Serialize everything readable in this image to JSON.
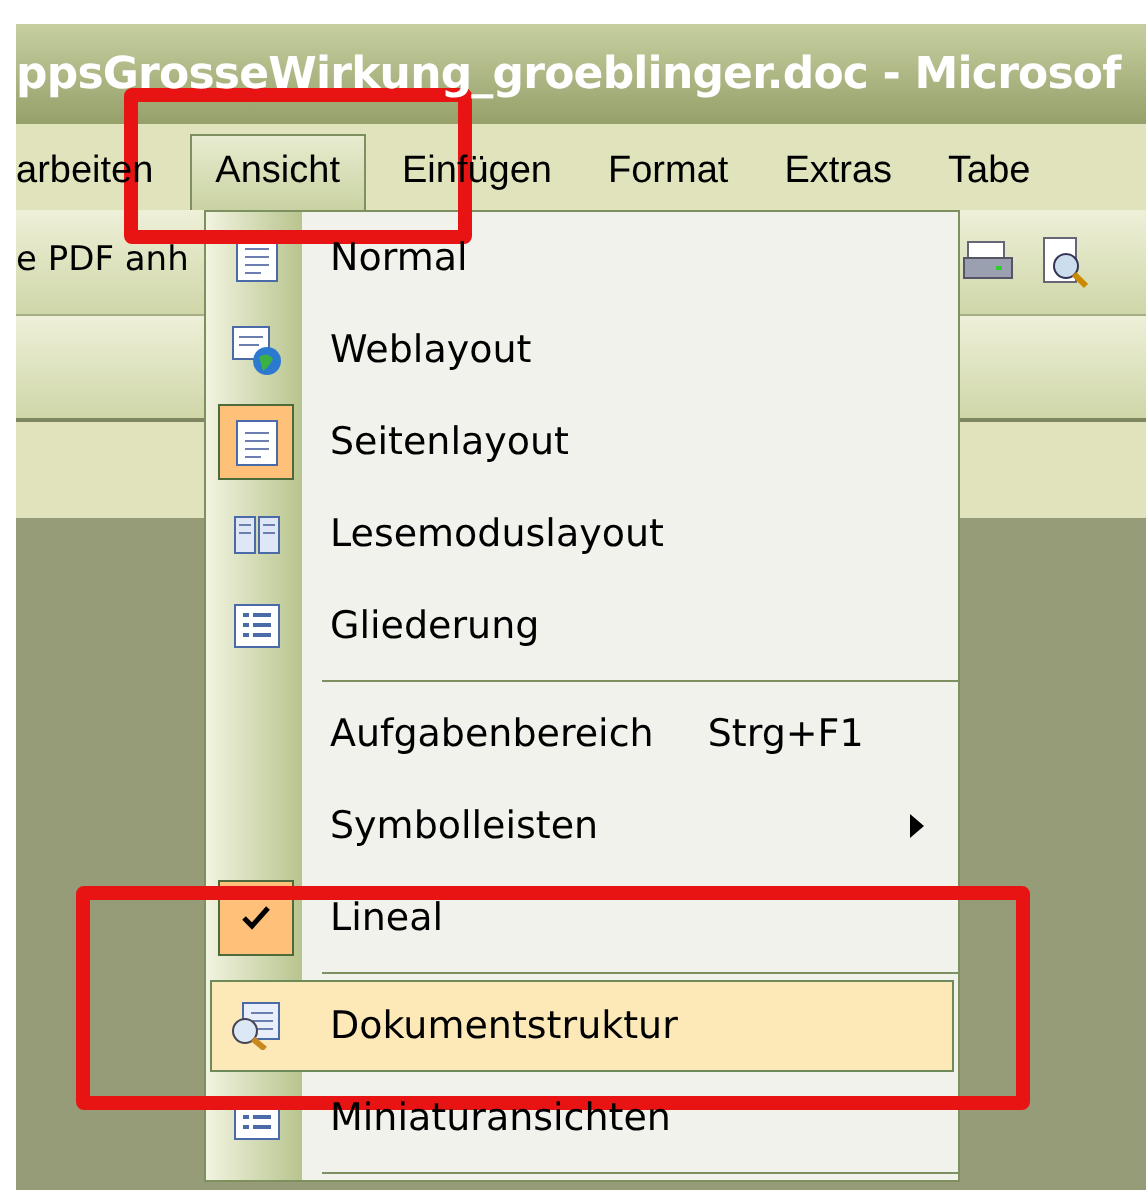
{
  "window": {
    "title": "ppsGrosseWirkung_groeblinger.doc - Microsof"
  },
  "menu_bar": [
    {
      "label": "arbeiten",
      "selected": false
    },
    {
      "label": "Ansicht",
      "selected": true
    },
    {
      "label": "Einfügen",
      "selected": false
    },
    {
      "label": "Format",
      "selected": false
    },
    {
      "label": "Extras",
      "selected": false
    },
    {
      "label": "Tabe",
      "selected": false
    }
  ],
  "toolbar": {
    "label": "e PDF anh"
  },
  "menu": [
    {
      "kind": "item",
      "label": "Normal",
      "checked": false,
      "highlighted": false
    },
    {
      "kind": "item",
      "label": "Weblayout",
      "checked": false,
      "highlighted": false
    },
    {
      "kind": "item",
      "label": "Seitenlayout",
      "checked": true,
      "highlighted": false
    },
    {
      "kind": "item",
      "label": "Lesemoduslayout",
      "checked": false,
      "highlighted": false
    },
    {
      "kind": "item",
      "label": "Gliederung",
      "checked": false,
      "highlighted": false
    },
    {
      "kind": "separator"
    },
    {
      "kind": "item",
      "label": "Aufgabenbereich",
      "shortcut": "Strg+F1",
      "checked": false,
      "highlighted": false
    },
    {
      "kind": "submenu",
      "label": "Symbolleisten",
      "checked": false,
      "highlighted": false
    },
    {
      "kind": "item",
      "label": "Lineal",
      "checked": true,
      "highlighted": false
    },
    {
      "kind": "separator"
    },
    {
      "kind": "item",
      "label": "Dokumentstruktur",
      "checked": false,
      "highlighted": true
    },
    {
      "kind": "item",
      "label": "Miniaturansichten",
      "checked": false,
      "highlighted": false
    },
    {
      "kind": "separator"
    }
  ]
}
